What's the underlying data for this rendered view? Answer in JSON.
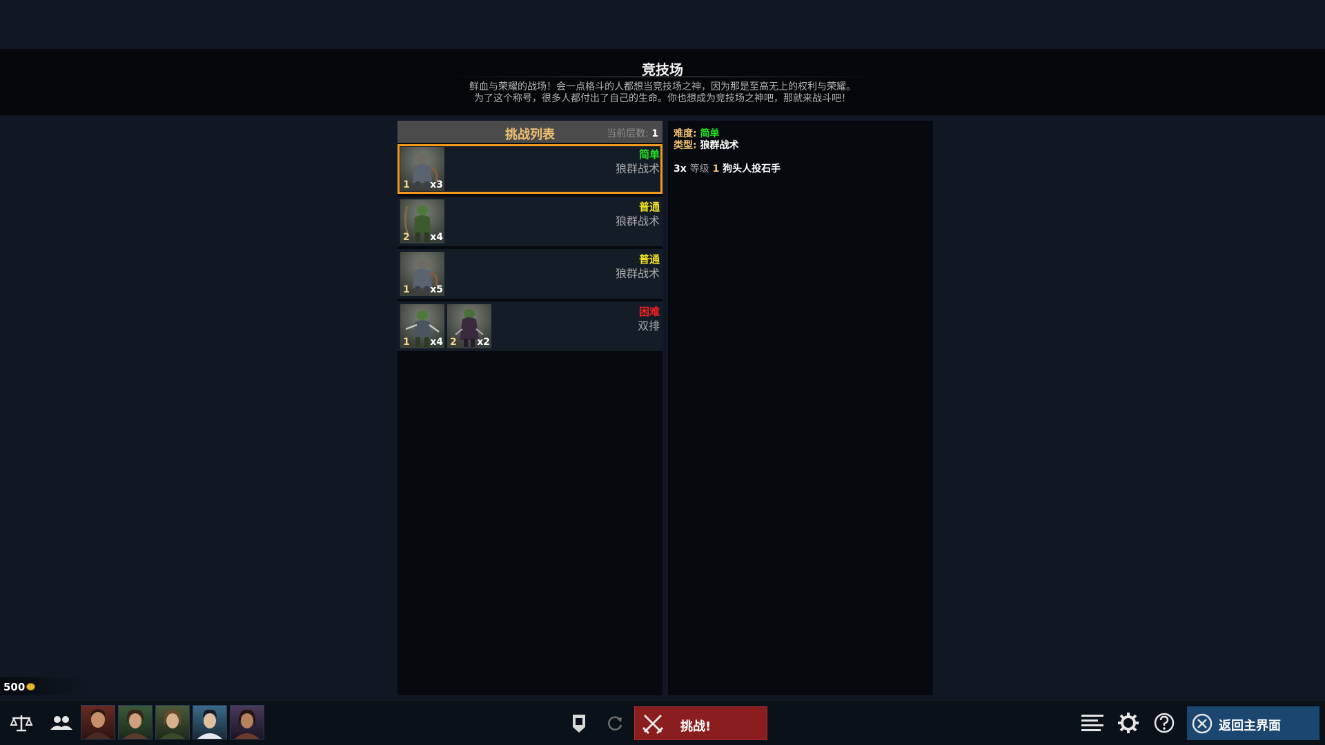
{
  "banner": {
    "title": "竞技场",
    "desc_line1": "鲜血与荣耀的战场！会一点格斗的人都想当竞技场之神，因为那是至高无上的权利与荣耀。",
    "desc_line2": "为了这个称号，很多人都付出了自己的生命。你也想成为竞技场之神吧，那就来战斗吧！"
  },
  "list": {
    "title": "挑战列表",
    "floor_label": "当前层数:",
    "floor_value": "1",
    "rows": [
      {
        "difficulty": "简单",
        "difficulty_color": "#22e022",
        "type": "狼群战术",
        "units": [
          {
            "level": "1",
            "count": "x3",
            "icon": "gnoll-slinger-icon"
          }
        ]
      },
      {
        "difficulty": "普通",
        "difficulty_color": "#f0e020",
        "type": "狼群战术",
        "units": [
          {
            "level": "2",
            "count": "x4",
            "icon": "goblin-archer-icon"
          }
        ]
      },
      {
        "difficulty": "普通",
        "difficulty_color": "#f0e020",
        "type": "狼群战术",
        "units": [
          {
            "level": "1",
            "count": "x5",
            "icon": "gnoll-slinger-icon"
          }
        ]
      },
      {
        "difficulty": "困难",
        "difficulty_color": "#ee2020",
        "type": "双排",
        "units": [
          {
            "level": "1",
            "count": "x4",
            "icon": "goblin-swordsman-icon"
          },
          {
            "level": "2",
            "count": "x2",
            "icon": "goblin-rogue-icon"
          }
        ]
      }
    ]
  },
  "detail": {
    "difficulty_label": "难度:",
    "difficulty_value": "简单",
    "type_label": "类型:",
    "type_value": "狼群战术",
    "enemy_count": "3x",
    "enemy_level_label": "等级",
    "enemy_level": "1",
    "enemy_name": "狗头人投石手"
  },
  "gold": {
    "value": "500",
    "icon": "gold-coin-icon"
  },
  "toolbar": {
    "balance_icon": "scales-icon",
    "party_icon": "party-icon",
    "portraits": [
      "hero-portrait-1",
      "hero-portrait-2",
      "hero-portrait-3",
      "hero-portrait-4",
      "hero-portrait-5"
    ],
    "formation_icon": "formation-icon",
    "refresh_icon": "refresh-icon",
    "challenge_label": "挑战!",
    "challenge_icon": "crossed-swords-icon",
    "log_icon": "log-icon",
    "settings_icon": "gear-icon",
    "help_icon": "help-icon",
    "return_label": "返回主界面",
    "return_icon": "close-circle-icon"
  }
}
